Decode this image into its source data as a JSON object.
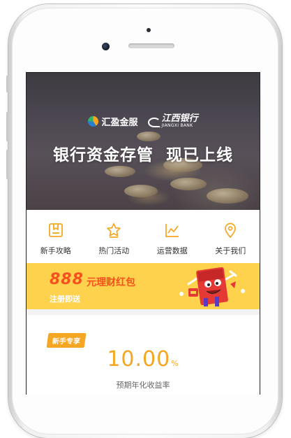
{
  "banner": {
    "brand_logo_text": "汇盈金服",
    "bank_logo_cn": "江西银行",
    "bank_logo_en": "JIANGXI BANK",
    "headline": "银行资金存管  现已上线"
  },
  "menu": {
    "items": [
      {
        "label": "新手攻略",
        "icon": "guide-icon"
      },
      {
        "label": "热门活动",
        "icon": "star-icon"
      },
      {
        "label": "运营数据",
        "icon": "chart-icon"
      },
      {
        "label": "关于我们",
        "icon": "location-pin-icon"
      }
    ],
    "accent_color": "#f5a623"
  },
  "promo": {
    "amount": "888",
    "title": "元理财红包",
    "subtitle": "注册即送",
    "background_color": "#ffd24d",
    "accent_color": "#f5501e"
  },
  "product": {
    "tag": "新手专享",
    "rate_value": "10.00",
    "rate_unit": "%",
    "rate_label": "预期年化收益率",
    "accent_color": "#f5a623"
  }
}
